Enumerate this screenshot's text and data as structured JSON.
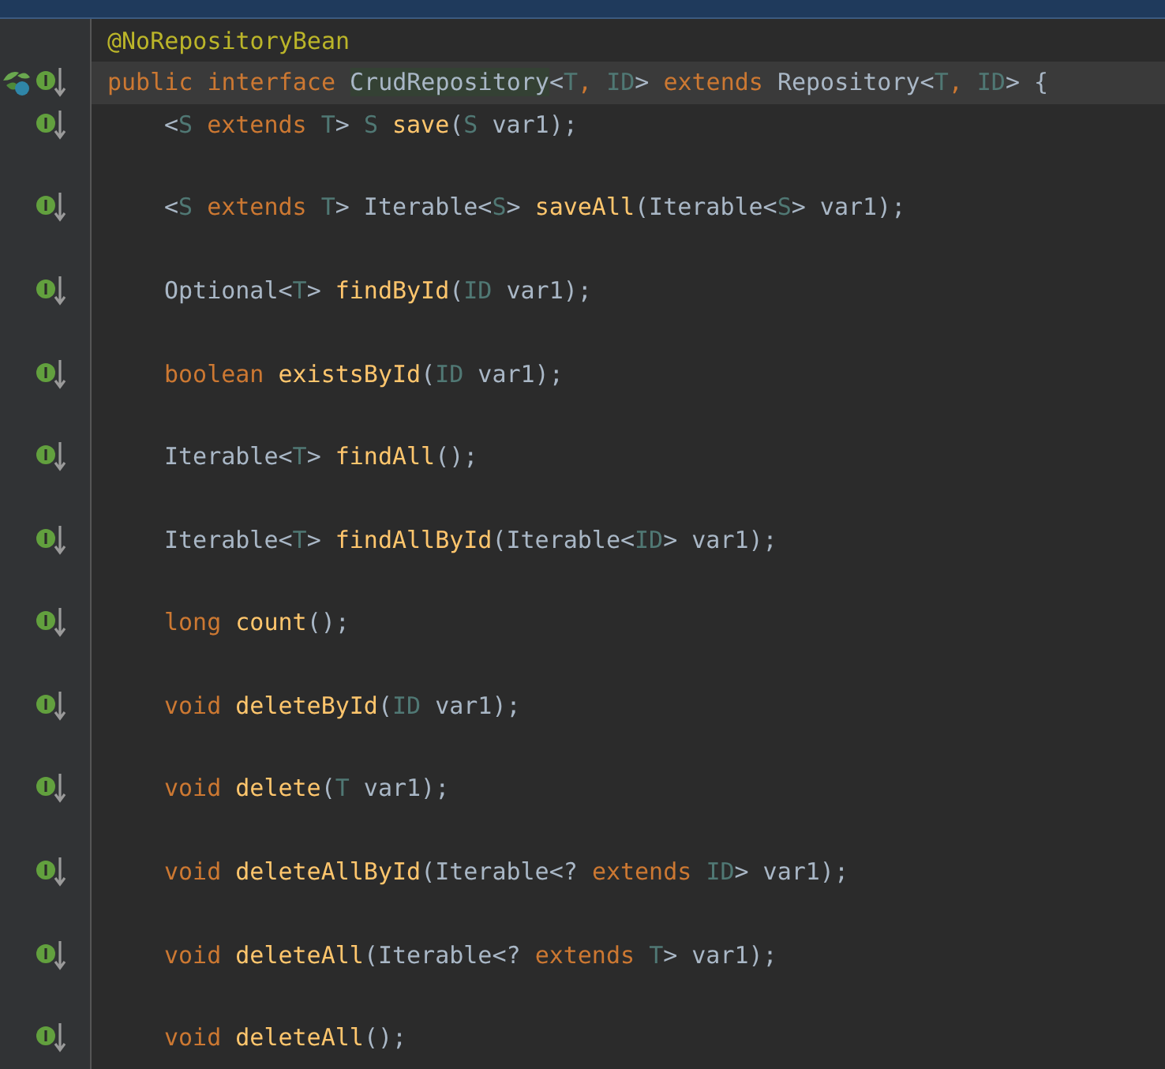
{
  "editor": {
    "lines": [
      {
        "indent": false,
        "tokens": [
          {
            "t": "@NoRepositoryBean",
            "kind": "annotation"
          }
        ]
      },
      {
        "current": true,
        "indent": false,
        "spring_bean": true,
        "implemented": true,
        "tokens": [
          {
            "t": "public ",
            "kind": "keyword"
          },
          {
            "t": "interface ",
            "kind": "keyword"
          },
          {
            "t": "CrudRepository",
            "kind": "usage"
          },
          {
            "t": "<",
            "kind": "plain"
          },
          {
            "t": "T",
            "kind": "typeparam"
          },
          {
            "t": ", ",
            "kind": "keyword"
          },
          {
            "t": "ID",
            "kind": "typeparam"
          },
          {
            "t": "> ",
            "kind": "plain"
          },
          {
            "t": "extends",
            "kind": "keyword"
          },
          {
            "t": " Repository<",
            "kind": "plain"
          },
          {
            "t": "T",
            "kind": "typeparam"
          },
          {
            "t": ", ",
            "kind": "keyword"
          },
          {
            "t": "ID",
            "kind": "typeparam"
          },
          {
            "t": "> {",
            "kind": "plain"
          }
        ]
      },
      {
        "gap_after": true,
        "indent": true,
        "implemented": true,
        "tokens": [
          {
            "t": "<",
            "kind": "plain"
          },
          {
            "t": "S ",
            "kind": "typeparam"
          },
          {
            "t": "extends ",
            "kind": "keyword"
          },
          {
            "t": "T",
            "kind": "typeparam"
          },
          {
            "t": "> ",
            "kind": "plain"
          },
          {
            "t": "S ",
            "kind": "typeparam"
          },
          {
            "t": "save",
            "kind": "method"
          },
          {
            "t": "(",
            "kind": "plain"
          },
          {
            "t": "S",
            "kind": "typeparam"
          },
          {
            "t": " var1);",
            "kind": "plain"
          }
        ]
      },
      {
        "gap_after": true,
        "indent": true,
        "implemented": true,
        "tokens": [
          {
            "t": "<",
            "kind": "plain"
          },
          {
            "t": "S ",
            "kind": "typeparam"
          },
          {
            "t": "extends ",
            "kind": "keyword"
          },
          {
            "t": "T",
            "kind": "typeparam"
          },
          {
            "t": "> Iterable<",
            "kind": "plain"
          },
          {
            "t": "S",
            "kind": "typeparam"
          },
          {
            "t": "> ",
            "kind": "plain"
          },
          {
            "t": "saveAll",
            "kind": "method"
          },
          {
            "t": "(Iterable<",
            "kind": "plain"
          },
          {
            "t": "S",
            "kind": "typeparam"
          },
          {
            "t": "> var1);",
            "kind": "plain"
          }
        ]
      },
      {
        "gap_after": true,
        "indent": true,
        "implemented": true,
        "tokens": [
          {
            "t": "Optional<",
            "kind": "plain"
          },
          {
            "t": "T",
            "kind": "typeparam"
          },
          {
            "t": "> ",
            "kind": "plain"
          },
          {
            "t": "findById",
            "kind": "method"
          },
          {
            "t": "(",
            "kind": "plain"
          },
          {
            "t": "ID",
            "kind": "typeparam"
          },
          {
            "t": " var1);",
            "kind": "plain"
          }
        ]
      },
      {
        "gap_after": true,
        "indent": true,
        "implemented": true,
        "tokens": [
          {
            "t": "boolean ",
            "kind": "keyword"
          },
          {
            "t": "existsById",
            "kind": "method"
          },
          {
            "t": "(",
            "kind": "plain"
          },
          {
            "t": "ID",
            "kind": "typeparam"
          },
          {
            "t": " var1);",
            "kind": "plain"
          }
        ]
      },
      {
        "gap_after": true,
        "indent": true,
        "implemented": true,
        "tokens": [
          {
            "t": "Iterable<",
            "kind": "plain"
          },
          {
            "t": "T",
            "kind": "typeparam"
          },
          {
            "t": "> ",
            "kind": "plain"
          },
          {
            "t": "findAll",
            "kind": "method"
          },
          {
            "t": "();",
            "kind": "plain"
          }
        ]
      },
      {
        "gap_after": true,
        "indent": true,
        "implemented": true,
        "tokens": [
          {
            "t": "Iterable<",
            "kind": "plain"
          },
          {
            "t": "T",
            "kind": "typeparam"
          },
          {
            "t": "> ",
            "kind": "plain"
          },
          {
            "t": "findAllById",
            "kind": "method"
          },
          {
            "t": "(Iterable<",
            "kind": "plain"
          },
          {
            "t": "ID",
            "kind": "typeparam"
          },
          {
            "t": "> var1);",
            "kind": "plain"
          }
        ]
      },
      {
        "gap_after": true,
        "indent": true,
        "implemented": true,
        "tokens": [
          {
            "t": "long ",
            "kind": "keyword"
          },
          {
            "t": "count",
            "kind": "method"
          },
          {
            "t": "();",
            "kind": "plain"
          }
        ]
      },
      {
        "gap_after": true,
        "indent": true,
        "implemented": true,
        "tokens": [
          {
            "t": "void ",
            "kind": "keyword"
          },
          {
            "t": "deleteById",
            "kind": "method"
          },
          {
            "t": "(",
            "kind": "plain"
          },
          {
            "t": "ID",
            "kind": "typeparam"
          },
          {
            "t": " var1);",
            "kind": "plain"
          }
        ]
      },
      {
        "gap_after": true,
        "indent": true,
        "implemented": true,
        "tokens": [
          {
            "t": "void ",
            "kind": "keyword"
          },
          {
            "t": "delete",
            "kind": "method"
          },
          {
            "t": "(",
            "kind": "plain"
          },
          {
            "t": "T",
            "kind": "typeparam"
          },
          {
            "t": " var1);",
            "kind": "plain"
          }
        ]
      },
      {
        "gap_after": true,
        "indent": true,
        "implemented": true,
        "tokens": [
          {
            "t": "void ",
            "kind": "keyword"
          },
          {
            "t": "deleteAllById",
            "kind": "method"
          },
          {
            "t": "(Iterable<? ",
            "kind": "plain"
          },
          {
            "t": "extends ",
            "kind": "keyword"
          },
          {
            "t": "ID",
            "kind": "typeparam"
          },
          {
            "t": "> var1);",
            "kind": "plain"
          }
        ]
      },
      {
        "gap_after": true,
        "indent": true,
        "implemented": true,
        "tokens": [
          {
            "t": "void ",
            "kind": "keyword"
          },
          {
            "t": "deleteAll",
            "kind": "method"
          },
          {
            "t": "(Iterable<? ",
            "kind": "plain"
          },
          {
            "t": "extends ",
            "kind": "keyword"
          },
          {
            "t": "T",
            "kind": "typeparam"
          },
          {
            "t": "> var1);",
            "kind": "plain"
          }
        ]
      },
      {
        "indent": true,
        "implemented": true,
        "tokens": [
          {
            "t": "void ",
            "kind": "keyword"
          },
          {
            "t": "deleteAll",
            "kind": "method"
          },
          {
            "t": "();",
            "kind": "plain"
          }
        ]
      }
    ]
  }
}
